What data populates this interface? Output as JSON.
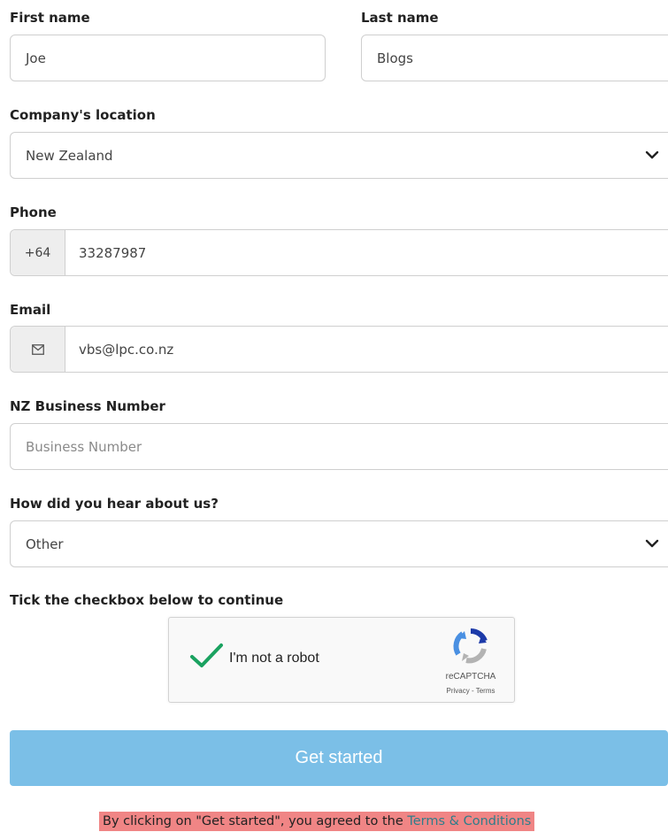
{
  "form": {
    "first_name": {
      "label": "First name",
      "value": "Joe"
    },
    "last_name": {
      "label": "Last name",
      "value": "Blogs"
    },
    "location": {
      "label": "Company's location",
      "value": "New Zealand"
    },
    "phone": {
      "label": "Phone",
      "prefix": "+64",
      "value": "33287987"
    },
    "email": {
      "label": "Email",
      "value": "vbs@lpc.co.nz",
      "icon": "envelope-icon"
    },
    "business_number": {
      "label": "NZ Business Number",
      "placeholder": "Business Number",
      "value": ""
    },
    "heard": {
      "label": "How did you hear about us?",
      "value": "Other"
    },
    "captcha": {
      "label": "Tick the checkbox below to continue",
      "text": "I'm not a robot",
      "brand": "reCAPTCHA",
      "links": "Privacy - Terms",
      "checked": true
    },
    "submit_label": "Get started",
    "terms_prefix": "By clicking on \"Get started\", you agreed to the ",
    "terms_link": "Terms & Conditions"
  },
  "colors": {
    "button": "#7bbfe7",
    "terms_highlight": "#f08585",
    "check": "#1aa260"
  }
}
